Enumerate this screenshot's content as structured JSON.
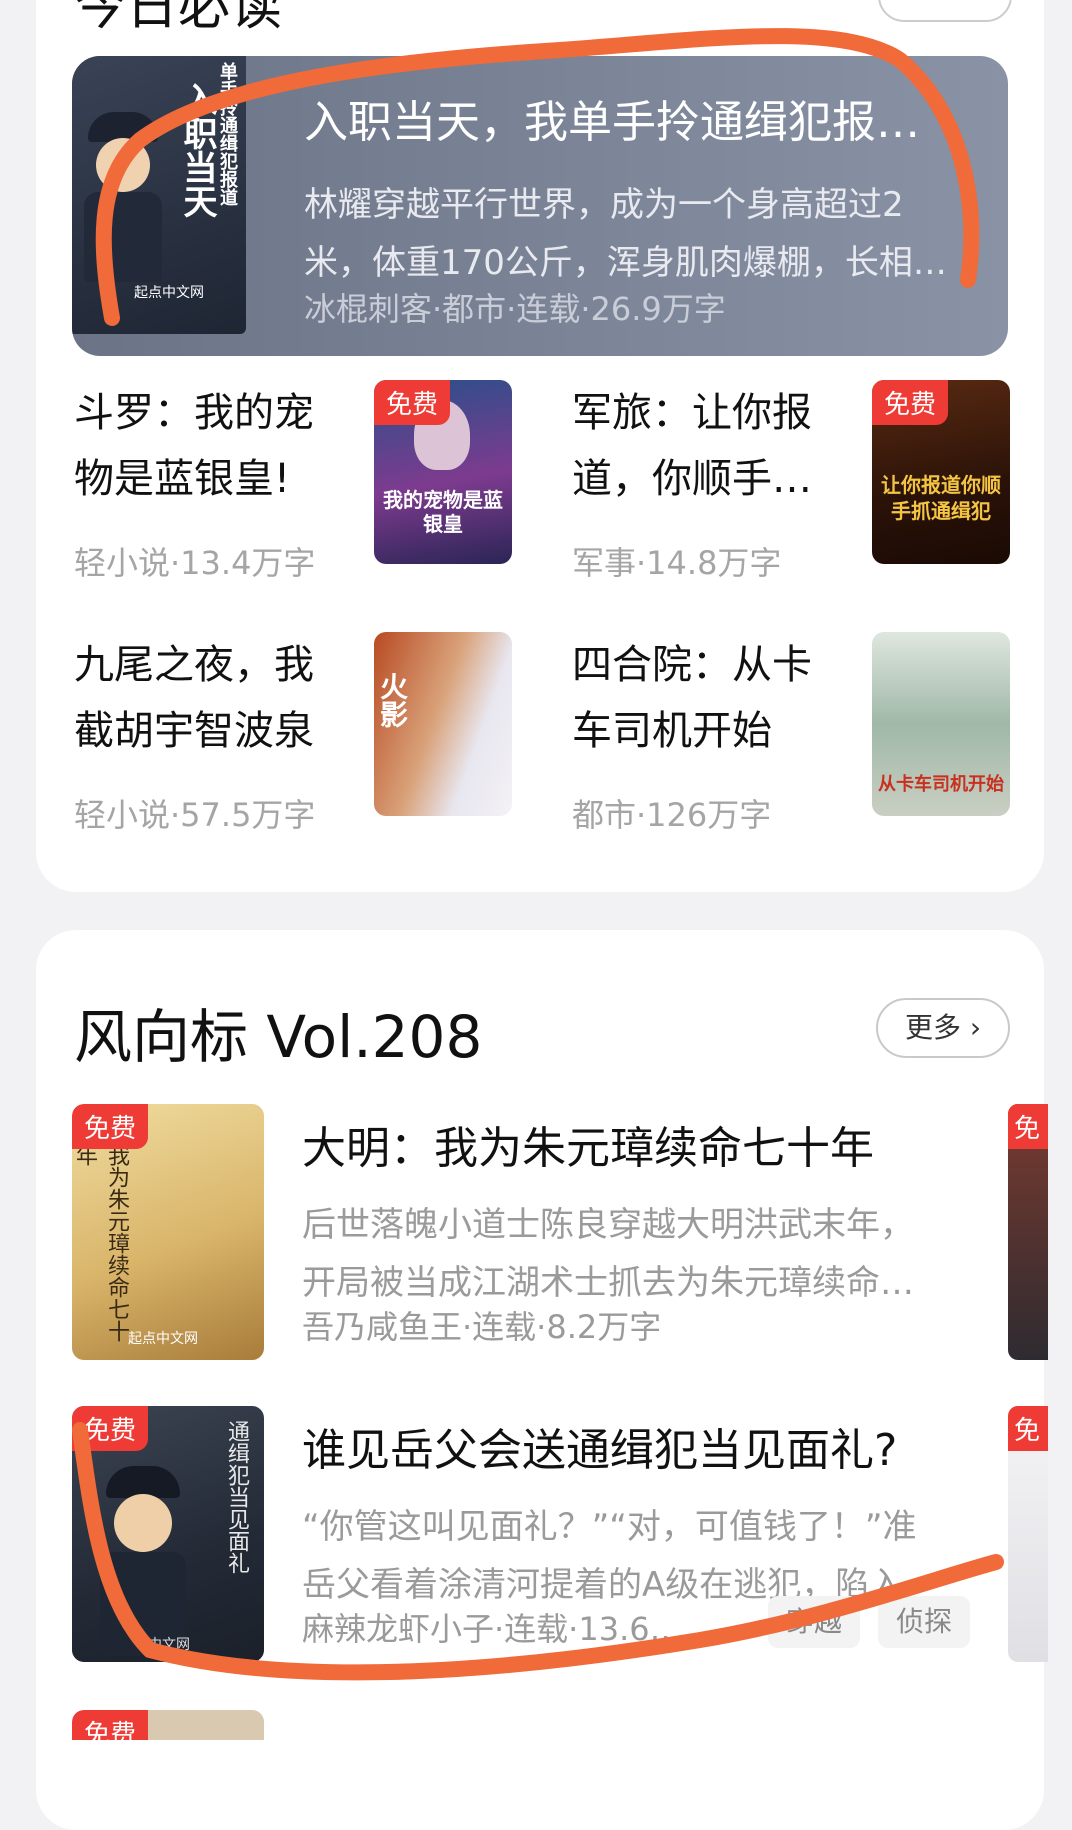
{
  "partial_section_title": "今日必读",
  "featured": {
    "title": "入职当天，我单手拎通缉犯报…",
    "description": "林耀穿越平行世界，成为一个身高超过2米，体重170公斤，浑身肌肉爆棚，长相…",
    "meta": "冰棍刺客·都市·连载·26.9万字",
    "cover_text": "入职当天",
    "cover_sub": "单手拎通缉犯报道",
    "cover_brand": "起点中文网"
  },
  "grid": [
    {
      "title": "斗罗：我的宠物是蓝银皇!",
      "meta": "轻小说·13.4万字",
      "badge": "免费",
      "cover_text": "我的宠物是蓝银皇"
    },
    {
      "title": "军旅：让你报道，你顺手…",
      "meta": "军事·14.8万字",
      "badge": "免费",
      "cover_text": "让你报道你顺手抓通缉犯"
    },
    {
      "title": "九尾之夜，我截胡宇智波泉",
      "meta": "轻小说·57.5万字",
      "badge": "",
      "cover_text": "火影"
    },
    {
      "title": "四合院：从卡车司机开始",
      "meta": "都市·126万字",
      "badge": "",
      "cover_text": "从卡车司机开始"
    }
  ],
  "section": {
    "title": "风向标 Vol.208",
    "more_label": "更多 ›"
  },
  "list": [
    {
      "title": "大明：我为朱元璋续命七十年",
      "description": "后世落魄小道士陈良穿越大明洪武末年，开局被当成江湖术士抓去为朱元璋续命…",
      "meta": "吾乃咸鱼王·连载·8.2万字",
      "badge": "免费",
      "tags": [],
      "cover_text": "我为朱元璋续命七十年",
      "cover_brand": "起点中文网"
    },
    {
      "title": "谁见岳父会送通缉犯当见面礼?",
      "description": "“你管这叫见面礼？”“对，可值钱了！”准岳父看着涂清河提着的A级在逃犯，陷入了…",
      "meta": "麻辣龙虾小子·连载·13.6…",
      "badge": "免费",
      "tags": [
        "穿越",
        "侦探"
      ],
      "cover_text": "通缉犯当见面礼",
      "cover_brand": "中文网"
    }
  ],
  "partial_next_badge": "免费",
  "colors": {
    "badge": "#ee3b35",
    "annotation": "#f06a3a"
  }
}
